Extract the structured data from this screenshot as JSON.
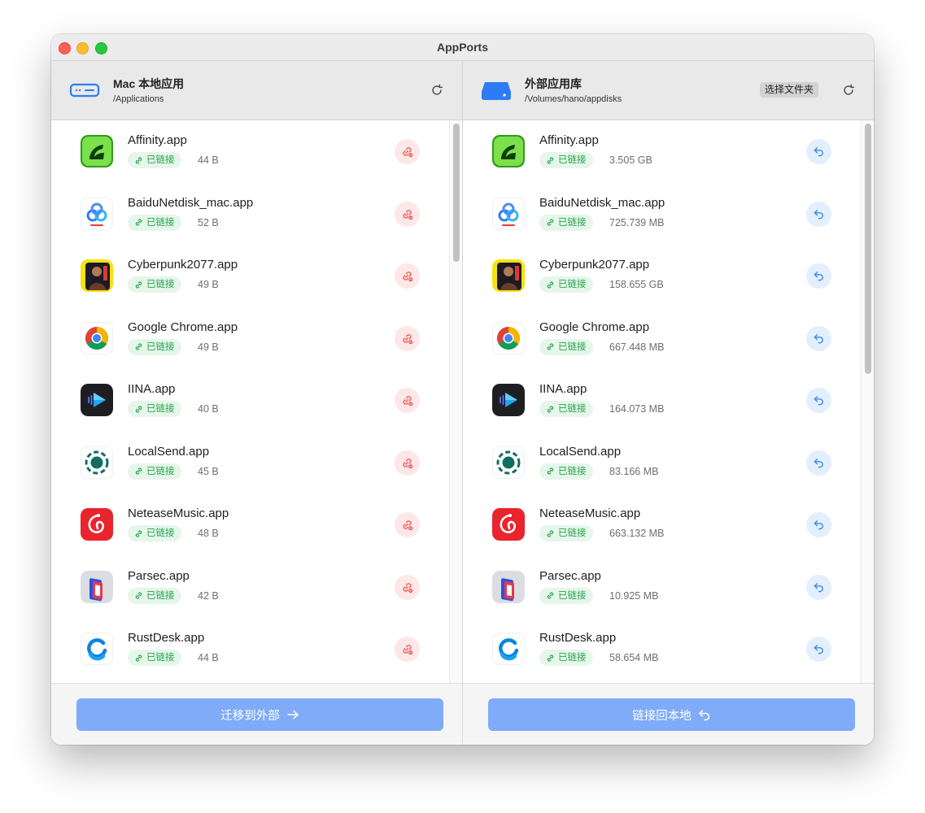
{
  "window": {
    "title": "AppPorts"
  },
  "left": {
    "title": "Mac 本地应用",
    "path": "/Applications",
    "footer_button": "迁移到外部",
    "apps": [
      {
        "name": "Affinity.app",
        "status": "已链接",
        "size": "44 B",
        "icon": "affinity-icon"
      },
      {
        "name": "BaiduNetdisk_mac.app",
        "status": "已链接",
        "size": "52 B",
        "icon": "baidunetdisk-icon"
      },
      {
        "name": "Cyberpunk2077.app",
        "status": "已链接",
        "size": "49 B",
        "icon": "cyberpunk-icon"
      },
      {
        "name": "Google Chrome.app",
        "status": "已链接",
        "size": "49 B",
        "icon": "chrome-icon"
      },
      {
        "name": "IINA.app",
        "status": "已链接",
        "size": "40 B",
        "icon": "iina-icon"
      },
      {
        "name": "LocalSend.app",
        "status": "已链接",
        "size": "45 B",
        "icon": "localsend-icon"
      },
      {
        "name": "NeteaseMusic.app",
        "status": "已链接",
        "size": "48 B",
        "icon": "neteasemusic-icon"
      },
      {
        "name": "Parsec.app",
        "status": "已链接",
        "size": "42 B",
        "icon": "parsec-icon"
      },
      {
        "name": "RustDesk.app",
        "status": "已链接",
        "size": "44 B",
        "icon": "rustdesk-icon"
      }
    ]
  },
  "right": {
    "title": "外部应用库",
    "path": "/Volumes/hano/appdisks",
    "choose_folder": "选择文件夹",
    "footer_button": "链接回本地",
    "apps": [
      {
        "name": "Affinity.app",
        "status": "已链接",
        "size": "3.505 GB",
        "icon": "affinity-icon"
      },
      {
        "name": "BaiduNetdisk_mac.app",
        "status": "已链接",
        "size": "725.739 MB",
        "icon": "baidunetdisk-icon"
      },
      {
        "name": "Cyberpunk2077.app",
        "status": "已链接",
        "size": "158.655 GB",
        "icon": "cyberpunk-icon"
      },
      {
        "name": "Google Chrome.app",
        "status": "已链接",
        "size": "667.448 MB",
        "icon": "chrome-icon"
      },
      {
        "name": "IINA.app",
        "status": "已链接",
        "size": "164.073 MB",
        "icon": "iina-icon"
      },
      {
        "name": "LocalSend.app",
        "status": "已链接",
        "size": "83.166 MB",
        "icon": "localsend-icon"
      },
      {
        "name": "NeteaseMusic.app",
        "status": "已链接",
        "size": "663.132 MB",
        "icon": "neteasemusic-icon"
      },
      {
        "name": "Parsec.app",
        "status": "已链接",
        "size": "10.925 MB",
        "icon": "parsec-icon"
      },
      {
        "name": "RustDesk.app",
        "status": "已链接",
        "size": "58.654 MB",
        "icon": "rustdesk-icon"
      }
    ]
  },
  "colors": {
    "linked_badge_bg": "#e6f6ea",
    "linked_badge_text": "#22a34a",
    "unlink_red": "#f05454",
    "restore_blue": "#3a8cf0",
    "primary_button": "#7fabf9"
  }
}
